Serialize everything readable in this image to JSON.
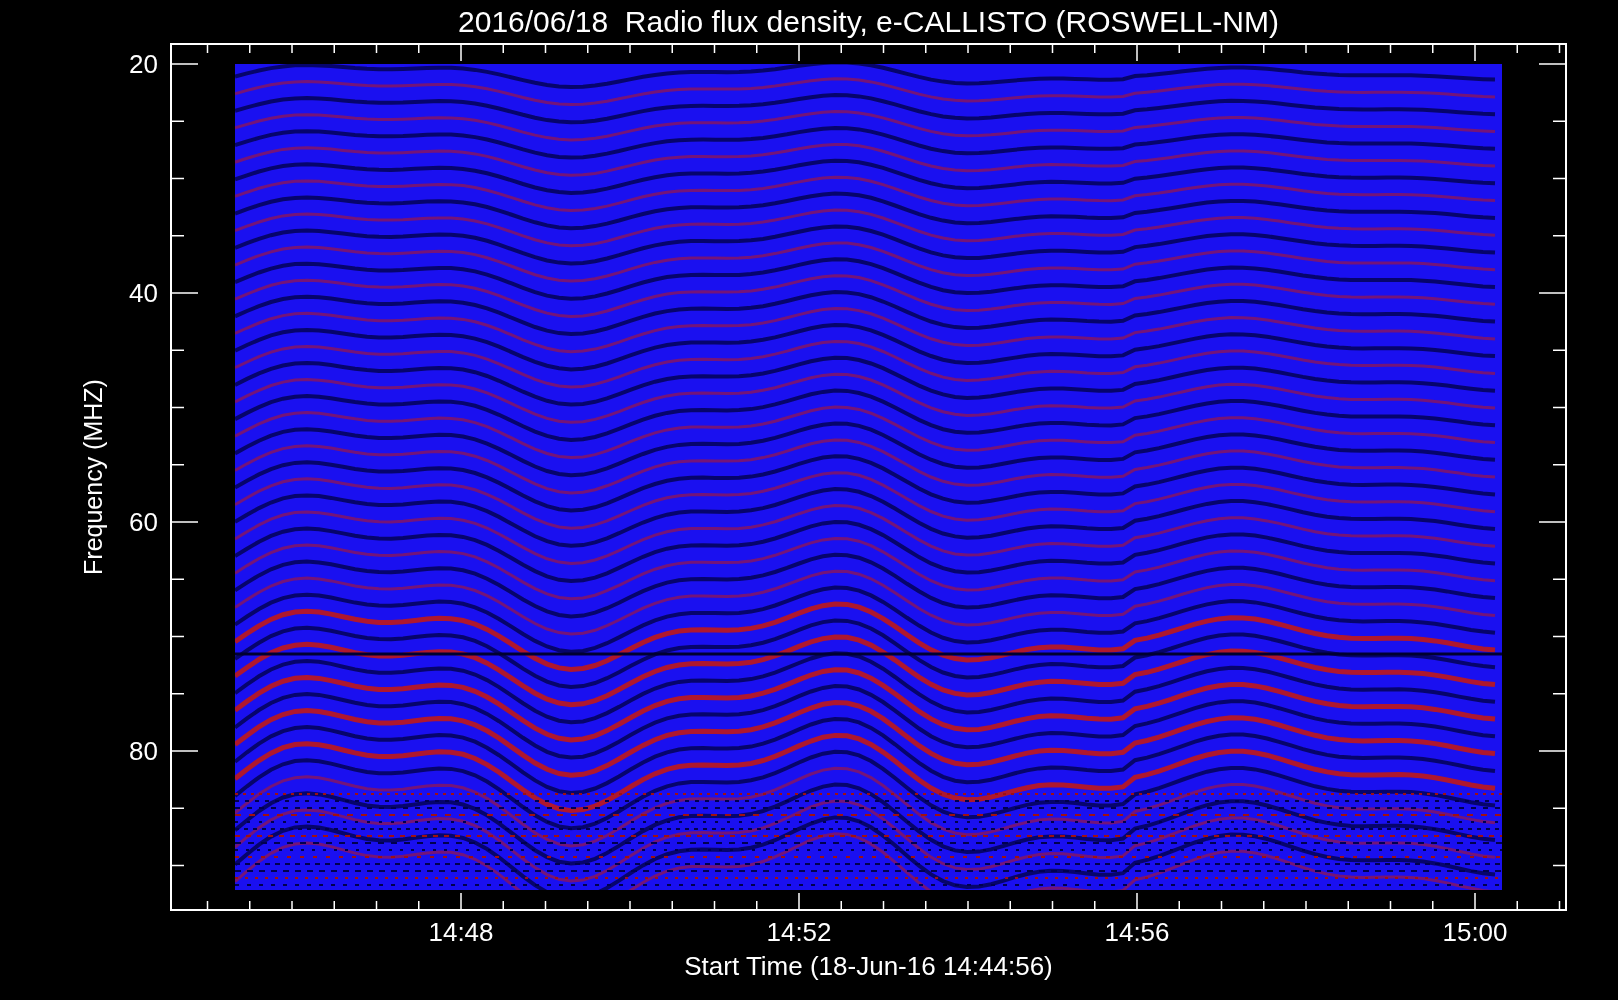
{
  "title": "2016/06/18  Radio flux density, e-CALLISTO (ROSWELL-NM)",
  "y_axis": {
    "label": "Frequency (MHZ)",
    "ticks": [
      "20",
      "40",
      "60",
      "80"
    ]
  },
  "x_axis": {
    "label": "Start Time (18-Jun-16 14:44:56)",
    "ticks": [
      "14:48",
      "14:52",
      "14:56",
      "15:00"
    ]
  }
}
